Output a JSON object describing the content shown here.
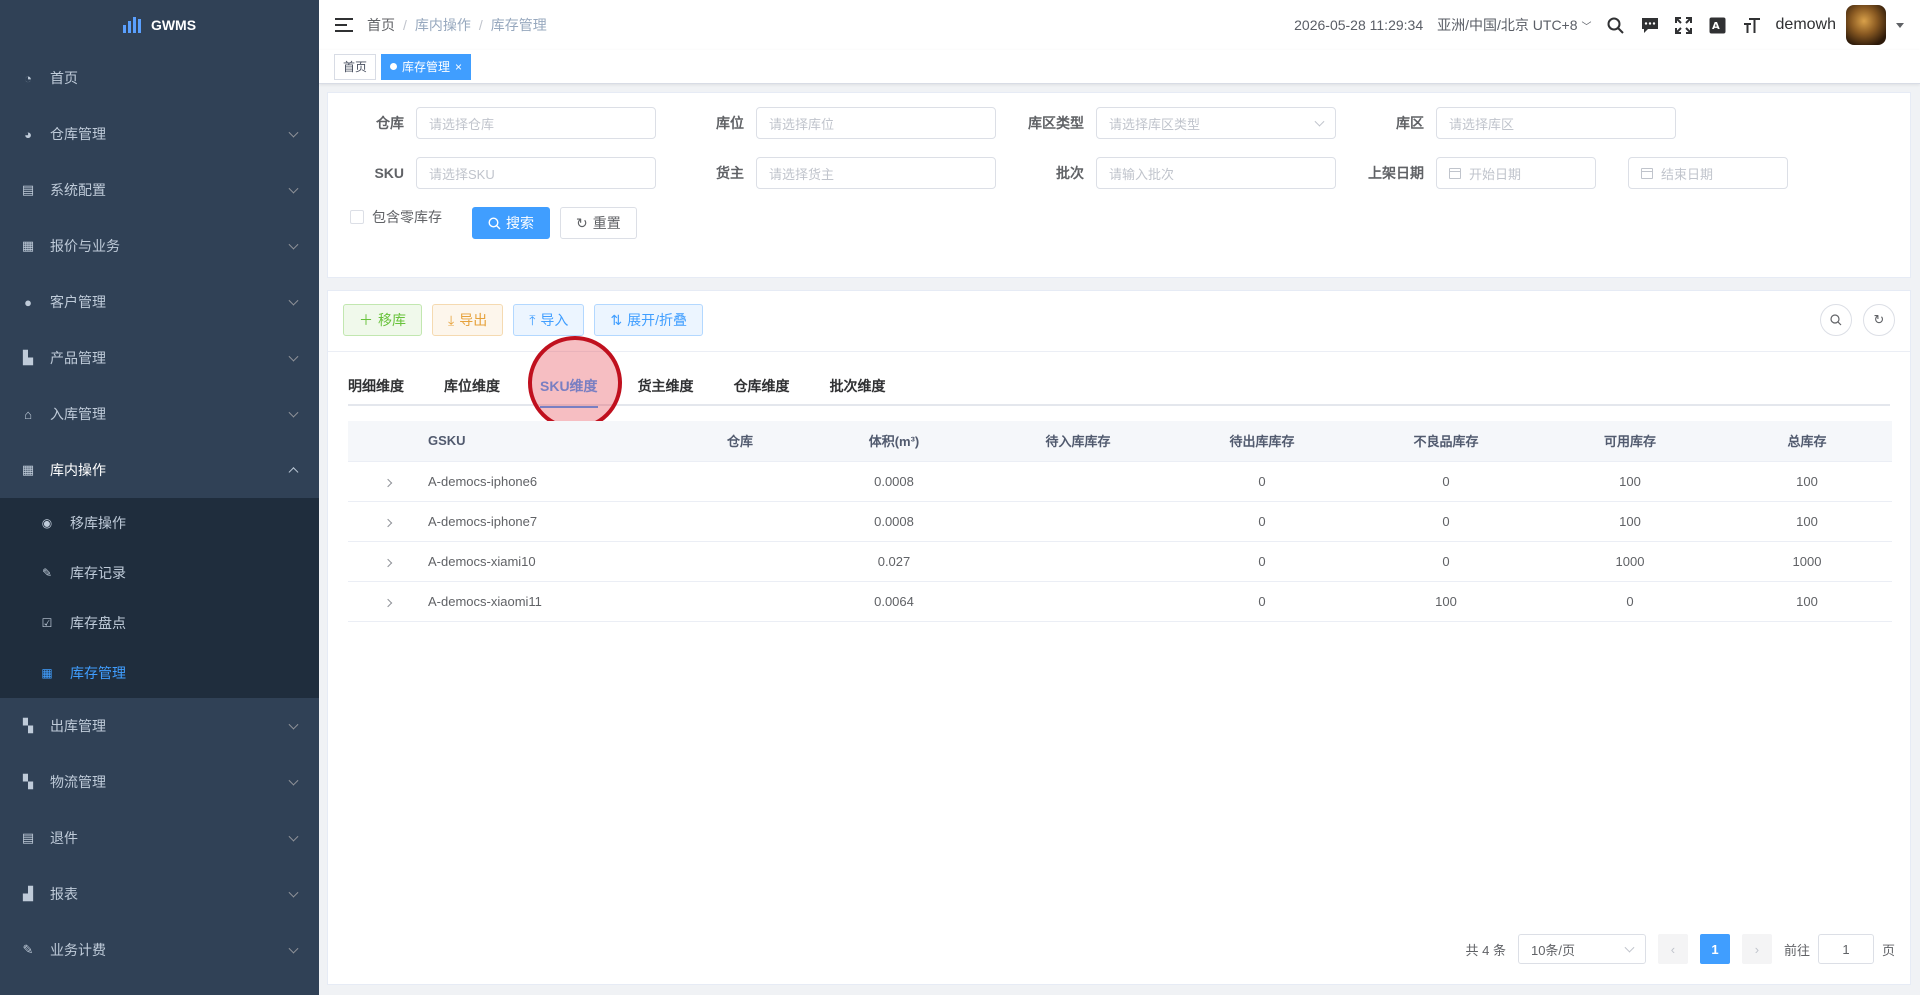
{
  "app": {
    "name": "GWMS"
  },
  "colors": {
    "sidebar_bg": "#304156",
    "accent": "#409eff",
    "submenu_bg": "#1f2d3d"
  },
  "sidebar": {
    "items": [
      {
        "label": "首页",
        "icon": "dashboard-icon"
      },
      {
        "label": "仓库管理",
        "icon": "globe-icon"
      },
      {
        "label": "系统配置",
        "icon": "server-icon"
      },
      {
        "label": "报价与业务",
        "icon": "document-icon"
      },
      {
        "label": "客户管理",
        "icon": "user-icon"
      },
      {
        "label": "产品管理",
        "icon": "cart-icon"
      },
      {
        "label": "入库管理",
        "icon": "home-icon"
      },
      {
        "label": "库内操作",
        "icon": "table-icon",
        "expanded": true
      }
    ],
    "sub_items": [
      {
        "label": "移库操作",
        "icon": "eye-icon"
      },
      {
        "label": "库存记录",
        "icon": "edit-icon"
      },
      {
        "label": "库存盘点",
        "icon": "checkbox-icon"
      },
      {
        "label": "库存管理",
        "icon": "table-icon",
        "active": true
      }
    ],
    "items_after": [
      {
        "label": "出库管理",
        "icon": "grid-icon"
      },
      {
        "label": "物流管理",
        "icon": "grid-icon"
      },
      {
        "label": "退件",
        "icon": "document-icon"
      },
      {
        "label": "报表",
        "icon": "chart-icon"
      },
      {
        "label": "业务计费",
        "icon": "edit-icon"
      }
    ]
  },
  "header": {
    "breadcrumb": [
      "首页",
      "库内操作",
      "库存管理"
    ],
    "datetime": "2026-05-28 11:29:34",
    "timezone": "亚洲/中国/北京 UTC+8",
    "username": "demowh"
  },
  "tags": {
    "home": "首页",
    "active": "库存管理"
  },
  "search": {
    "warehouse_label": "仓库",
    "warehouse_placeholder": "请选择仓库",
    "location_label": "库位",
    "location_placeholder": "请选择库位",
    "zone_type_label": "库区类型",
    "zone_type_placeholder": "请选择库区类型",
    "zone_label": "库区",
    "zone_placeholder": "请选择库区",
    "sku_label": "SKU",
    "sku_placeholder": "请选择SKU",
    "owner_label": "货主",
    "owner_placeholder": "请选择货主",
    "batch_label": "批次",
    "batch_placeholder": "请输入批次",
    "shelf_date_label": "上架日期",
    "start_date_placeholder": "开始日期",
    "end_date_placeholder": "结束日期",
    "include_zero_label": "包含零库存",
    "search_button": "搜索",
    "reset_button": "重置"
  },
  "toolbar": {
    "move": "移库",
    "export": "导出",
    "import": "导入",
    "expand": "展开/折叠"
  },
  "tabs": [
    "明细维度",
    "库位维度",
    "SKU维度",
    "货主维度",
    "仓库维度",
    "批次维度"
  ],
  "active_tab": "SKU维度",
  "table": {
    "headers": [
      "GSKU",
      "仓库",
      "体积(m³)",
      "待入库库存",
      "待出库库存",
      "不良品库存",
      "可用库存",
      "总库存"
    ],
    "rows": [
      {
        "gsku": "A-democs-iphone6",
        "warehouse": "",
        "volume": "0.0008",
        "pending_in": "",
        "pending_out": "0",
        "defective": "0",
        "available": "100",
        "total": "100"
      },
      {
        "gsku": "A-democs-iphone7",
        "warehouse": "",
        "volume": "0.0008",
        "pending_in": "",
        "pending_out": "0",
        "defective": "0",
        "available": "100",
        "total": "100"
      },
      {
        "gsku": "A-democs-xiami10",
        "warehouse": "",
        "volume": "0.027",
        "pending_in": "",
        "pending_out": "0",
        "defective": "0",
        "available": "1000",
        "total": "1000"
      },
      {
        "gsku": "A-democs-xiaomi11",
        "warehouse": "",
        "volume": "0.0064",
        "pending_in": "",
        "pending_out": "0",
        "defective": "100",
        "available": "0",
        "total": "100"
      }
    ]
  },
  "pagination": {
    "total_text": "共 4 条",
    "page_size": "10条/页",
    "current_page": "1",
    "goto_label": "前往",
    "goto_value": "1",
    "page_unit": "页"
  }
}
